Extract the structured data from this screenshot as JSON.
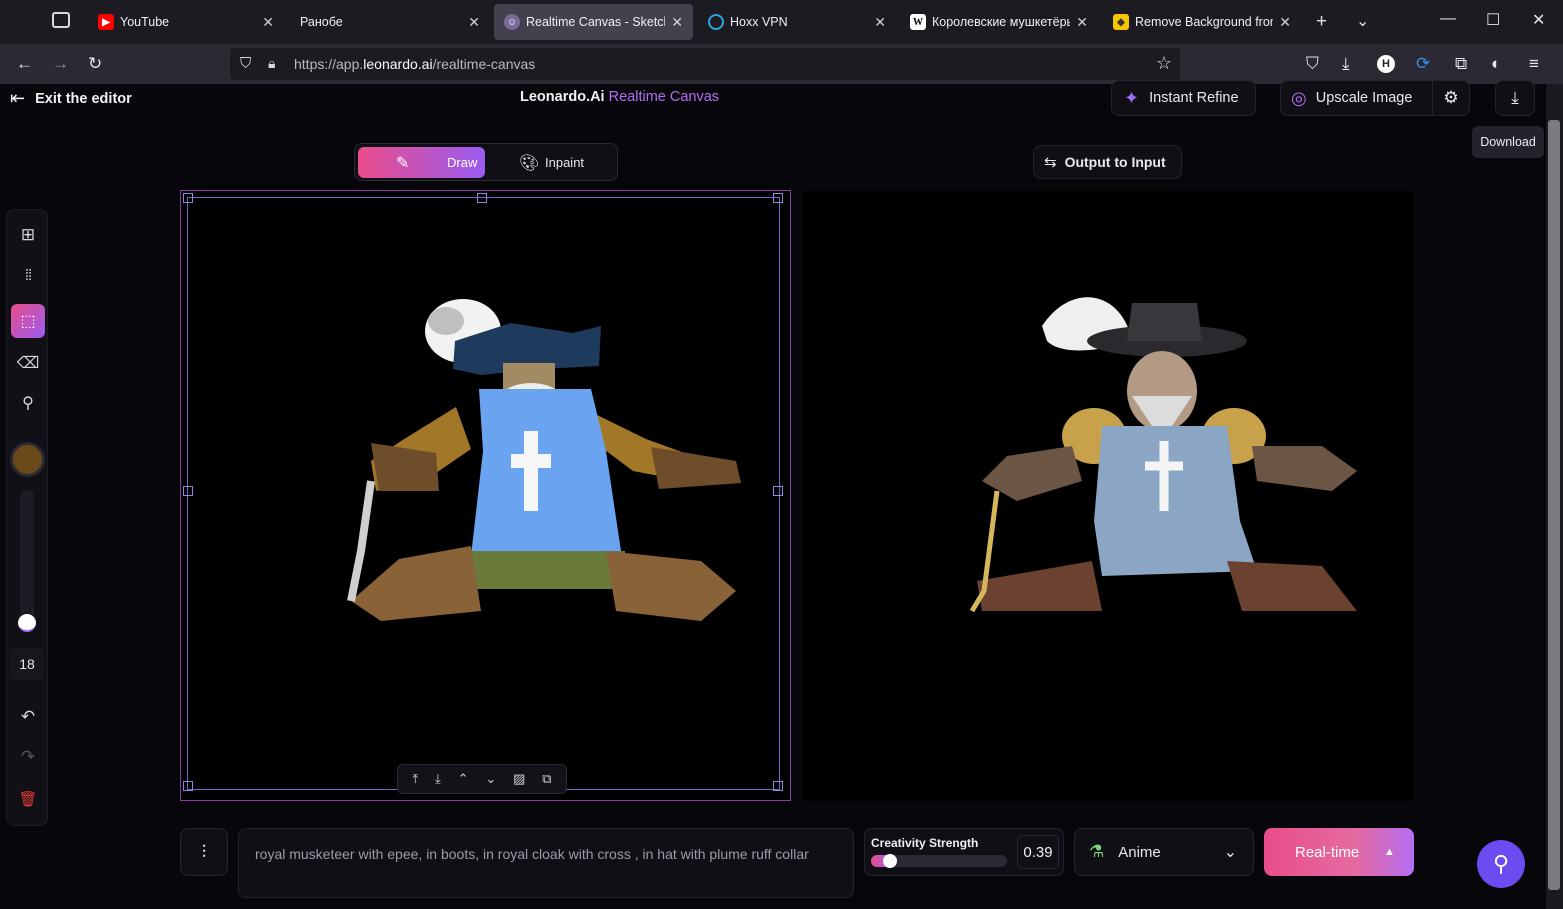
{
  "browser": {
    "tabs": [
      {
        "title": "YouTube",
        "favicon": "youtube-icon"
      },
      {
        "title": "Ранобе",
        "favicon": ""
      },
      {
        "title": "Realtime Canvas - Sketch to",
        "favicon": "leonardo-icon"
      },
      {
        "title": "Hoxx VPN",
        "favicon": "hoxx-icon"
      },
      {
        "title": "Королевские мушкетёры -",
        "favicon": "wikipedia-icon"
      },
      {
        "title": "Remove Background from I",
        "favicon": "removebg-icon"
      }
    ],
    "url_prefix": "https://app.",
    "url_domain": "leonardo.ai",
    "url_path": "/realtime-canvas"
  },
  "header": {
    "exit_label": "Exit the editor",
    "brand": "Leonardo.Ai",
    "product": "Realtime Canvas",
    "instant_refine_label": "Instant Refine",
    "upscale_label": "Upscale Image",
    "download_tooltip": "Download"
  },
  "mode_toggle": {
    "draw_label": "Draw",
    "inpaint_label": "Inpaint",
    "active": "Draw"
  },
  "output_to_input_label": "Output to Input",
  "toolbar": {
    "brush_size": "18",
    "brush_color": "#6b4a1a"
  },
  "prompt": {
    "text": "royal musketeer with epee, in boots, in royal cloak with cross , in hat with plume ruff collar"
  },
  "creativity": {
    "label": "Creativity Strength",
    "value": "0.39"
  },
  "style": {
    "label": "Anime"
  },
  "generate": {
    "label": "Real-time"
  },
  "colors": {
    "accent_pink": "#e95d8d",
    "accent_purple": "#a06cf5",
    "brand_gradient_start": "#e94d8a",
    "brand_gradient_end": "#9a5cf2"
  }
}
